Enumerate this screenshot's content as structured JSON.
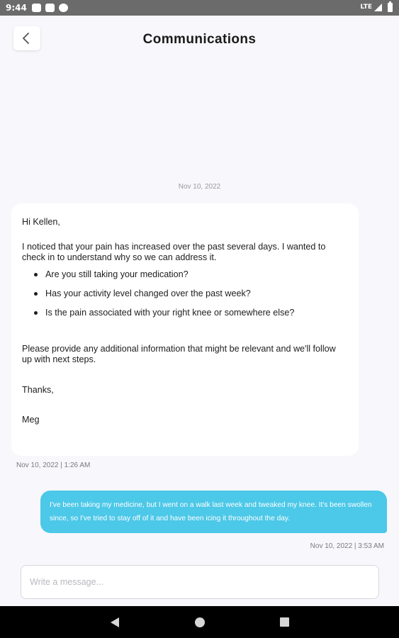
{
  "status_bar": {
    "time": "9:44",
    "network": "LTE",
    "icons": [
      "notification-icon",
      "notification-icon",
      "notification-icon",
      "signal-icon",
      "battery-icon"
    ]
  },
  "header": {
    "title": "Communications",
    "back_icon": "chevron-left-icon"
  },
  "thread": {
    "date_separator": "Nov 10, 2022",
    "incoming": {
      "greeting": "Hi Kellen,",
      "paragraph1": "I noticed that your pain has increased over the past several days. I wanted to check in to understand why so we can address it.",
      "bullets": [
        "Are you still taking your medication?",
        "Has your activity level changed over the past week?",
        "Is the pain associated with your right knee or somewhere else?"
      ],
      "paragraph2": "Please provide any additional information that might be relevant and we'll follow up with next steps.",
      "thanks": "Thanks,",
      "signature": "Meg",
      "timestamp": "Nov 10, 2022 | 1:26 AM"
    },
    "outgoing": {
      "text": "I've been taking my medicine, but I went on a walk last week and tweaked my knee. It's been swollen since, so I've tried to stay off of it and have been icing it throughout the day.",
      "timestamp": "Nov 10, 2022 | 3:53 AM"
    }
  },
  "composer": {
    "placeholder": "Write a message...",
    "value": ""
  },
  "colors": {
    "accent": "#4cc8e8",
    "background": "#f7f7fc",
    "status_bar": "#6b6b6b"
  }
}
